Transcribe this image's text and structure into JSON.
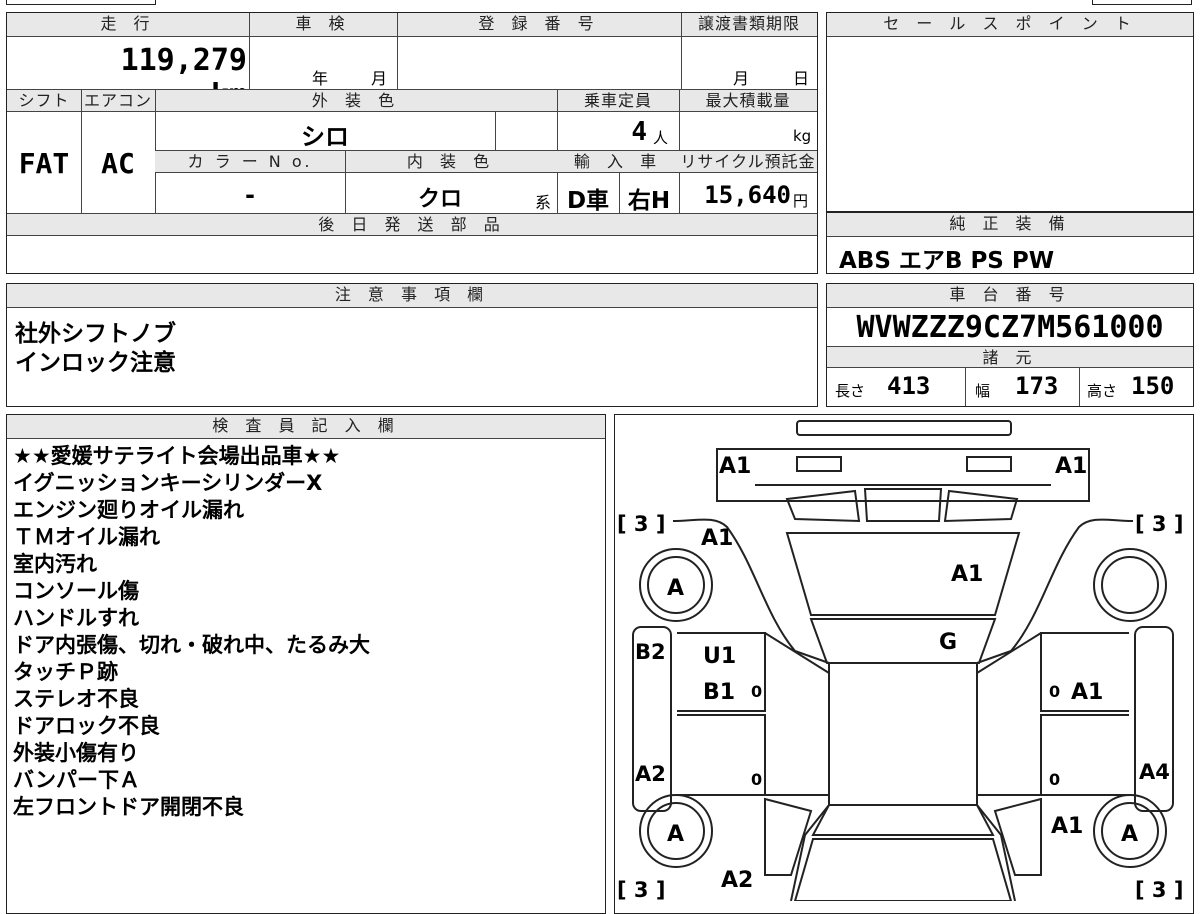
{
  "main": {
    "mileage_label": "走 行",
    "mileage_value": "119,279 km",
    "inspection_label": "車 検",
    "year_unit": "年",
    "month_unit": "月",
    "registration_label": "登 録 番 号",
    "transfer_deadline_label": "譲渡書類期限",
    "transfer_month_unit": "月",
    "transfer_day_unit": "日",
    "shift_label": "シフト",
    "shift_value": "FAT",
    "aircon_label": "エアコン",
    "aircon_value": "AC",
    "exterior_color_label": "外 装 色",
    "exterior_color_value": "シロ",
    "capacity_label": "乗車定員",
    "capacity_value": "4",
    "capacity_unit": "人",
    "max_load_label": "最大積載量",
    "max_load_unit": "kg",
    "color_no_label": "カ ラ ー N o.",
    "color_no_value": "-",
    "interior_color_label": "内 装 色",
    "interior_color_value": "クロ",
    "interior_color_unit": "系",
    "import_label": "輸 入 車",
    "import_type": "D車",
    "steering": "右H",
    "recycle_label": "リサイクル預託金",
    "recycle_value": "15,640",
    "recycle_unit": "円",
    "later_parts_label": "後 日 発 送 部 品"
  },
  "sales_point": {
    "label": "セ ー ル ス ポ イ ン ト"
  },
  "genuine_equipment": {
    "label": "純 正 装 備",
    "value": "ABS エアB PS PW"
  },
  "caution": {
    "label": "注 意 事 項 欄",
    "lines": [
      "社外シフトノブ",
      "インロック注意"
    ]
  },
  "chassis": {
    "label": "車 台 番 号",
    "value": "WVWZZZ9CZ7M561000"
  },
  "specs": {
    "label": "諸 元",
    "length_label": "長さ",
    "length_value": "413",
    "width_label": "幅",
    "width_value": "173",
    "height_label": "高さ",
    "height_value": "150"
  },
  "inspector": {
    "label": "検 査 員 記 入 欄",
    "lines": [
      "★★愛媛サテライト会場出品車★★",
      "イグニッションキーシリンダーX",
      "エンジン廻りオイル漏れ",
      "ＴＭオイル漏れ",
      "室内汚れ",
      "コンソール傷",
      "ハンドルすれ",
      "ドア内張傷、切れ・破れ中、たるみ大",
      "タッチＰ跡",
      "ステレオ不良",
      "ドアロック不良",
      "外装小傷有り",
      "バンパー下Ａ",
      "左フロントドア開閉不良"
    ]
  },
  "diagram": {
    "front_left": "A1",
    "front_right": "A1",
    "left_fender": "A1",
    "hood": "A1",
    "windshield": "G",
    "left_front_door_1": "U1",
    "left_front_door_2": "B1",
    "left_rocker_front": "B2",
    "left_rocker_rear": "A2",
    "right_front_door": "A1",
    "right_rocker_rear": "A4",
    "right_rear_quarter": "A1",
    "rear_left": "A2",
    "tire_fl": "A",
    "tire_rl": "A",
    "tire_rr": "A",
    "tread_fl": "[ 3 ]",
    "tread_fr": "[ 3 ]",
    "tread_rl": "[ 3 ]",
    "tread_rr": "[ 3 ]",
    "zero": "0"
  }
}
